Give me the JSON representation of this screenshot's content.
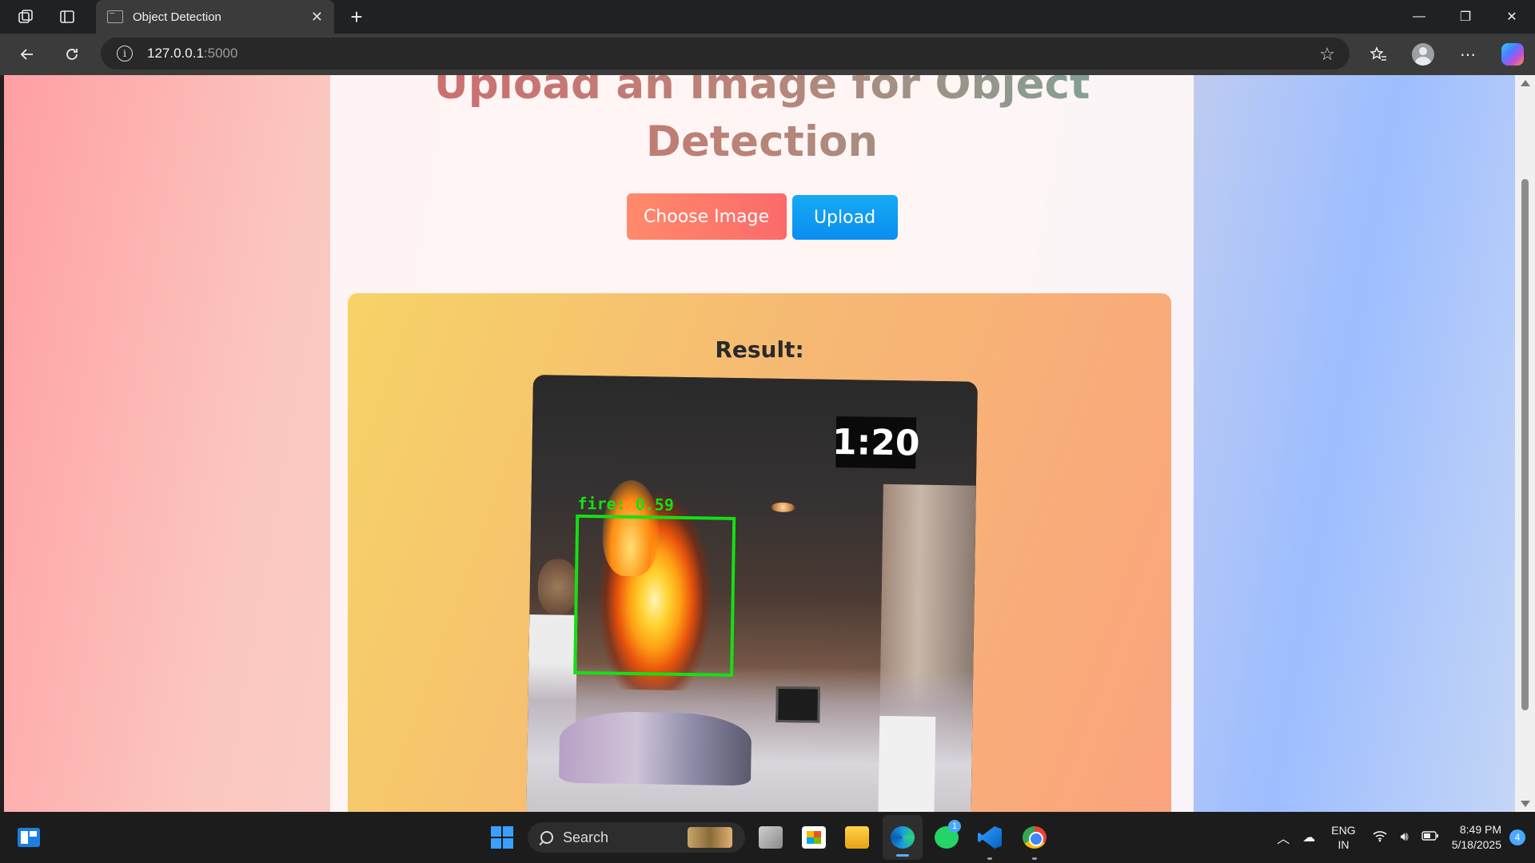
{
  "browser": {
    "tab_title": "Object Detection",
    "tab_close": "✕",
    "new_tab": "+",
    "url_host": "127.0.0.1",
    "url_port": ":5000",
    "window_controls": {
      "minimize": "—",
      "restore": "❐",
      "close": "✕"
    },
    "icons": [
      "workspaces-icon",
      "vertical-tabs-icon",
      "back-icon",
      "refresh-icon",
      "site-info-icon",
      "favorite-star-icon",
      "favorites-icon",
      "profile-icon",
      "more-icon",
      "copilot-icon"
    ]
  },
  "page": {
    "title": "Upload an Image for Object Detection",
    "choose_button": "Choose Image",
    "upload_button": "Upload",
    "result_heading": "Result:",
    "image": {
      "timer_text": "1:20",
      "detection_label": "fire: 0.59",
      "detection_color": "#14e014"
    }
  },
  "taskbar": {
    "search_label": "Search",
    "apps": [
      "task-view",
      "microsoft-store",
      "file-explorer",
      "edge",
      "whatsapp",
      "vscode",
      "chrome"
    ],
    "whatsapp_badge": "1",
    "language_top": "ENG",
    "language_bottom": "IN",
    "time": "8:49 PM",
    "date": "5/18/2025",
    "notification_count": "4"
  },
  "colors": {
    "choose_button": "#fb7a6a",
    "upload_button": "#0a9cf0",
    "result_panel_start": "#f6d367",
    "result_panel_end": "#fba37e"
  }
}
